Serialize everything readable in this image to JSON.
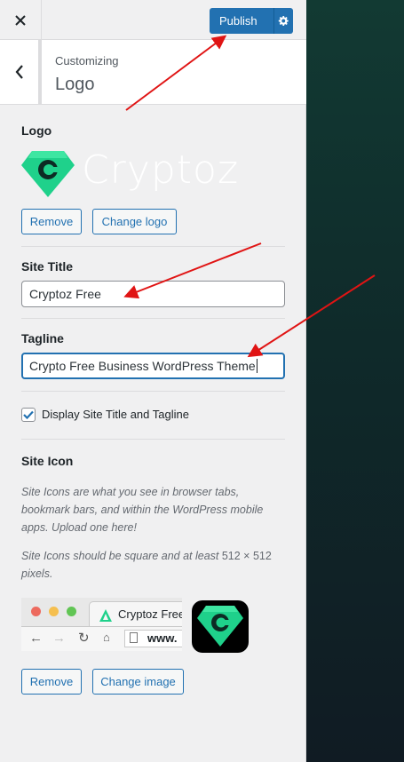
{
  "header": {
    "publish_label": "Publish"
  },
  "section": {
    "customizing_label": "Customizing",
    "title": "Logo"
  },
  "logo": {
    "label": "Logo",
    "brand_text": "Cryptoz",
    "remove_label": "Remove",
    "change_label": "Change logo"
  },
  "site_title": {
    "label": "Site Title",
    "value": "Cryptoz Free"
  },
  "tagline": {
    "label": "Tagline",
    "value": "Crypto Free Business WordPress Theme"
  },
  "display_toggle": {
    "label": "Display Site Title and Tagline",
    "checked": true
  },
  "site_icon": {
    "label": "Site Icon",
    "description_1": "Site Icons are what you see in browser tabs, bookmark bars, and within the WordPress mobile apps. Upload one here!",
    "description_2_prefix": "Site Icons should be square and at least ",
    "description_2_size": "512 × 512",
    "description_2_suffix": " pixels.",
    "preview_tab_title": "Cryptoz Free",
    "preview_url": "www.",
    "remove_label": "Remove",
    "change_label": "Change image"
  },
  "colors": {
    "primary": "#2271b1",
    "logo_green": "#1fd18b",
    "annotation_arrow": "#e01414"
  }
}
